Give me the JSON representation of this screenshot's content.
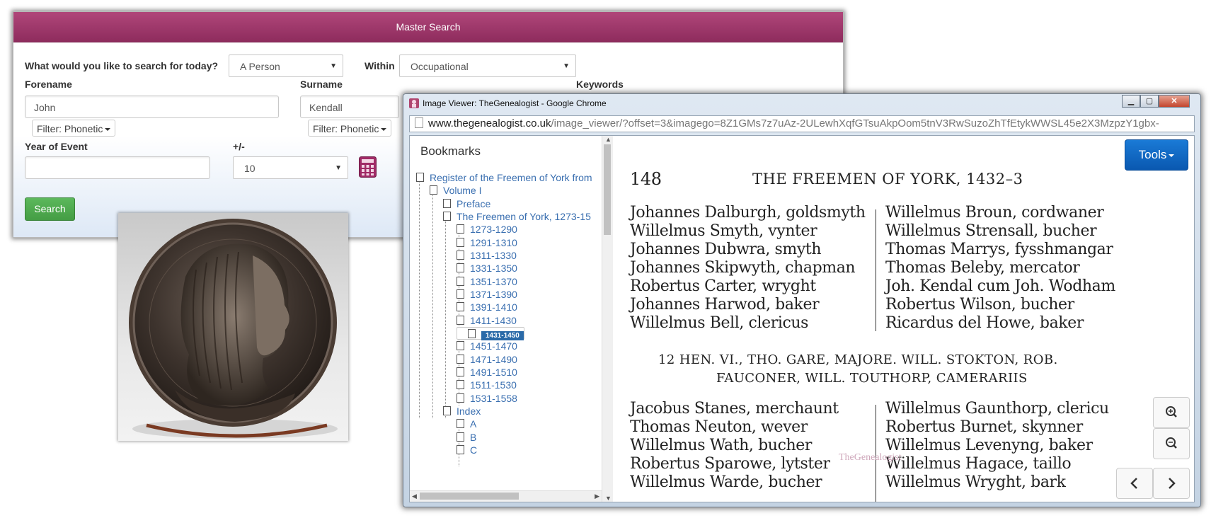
{
  "master_search": {
    "title": "Master Search",
    "question_label": "What would you like to search for today?",
    "search_type": "A Person",
    "within_label": "Within",
    "within_value": "Occupational",
    "forename_label": "Forename",
    "forename_value": "John",
    "forename_filter": "Filter: Phonetic",
    "surname_label": "Surname",
    "surname_value": "Kendall",
    "surname_filter": "Filter: Phonetic",
    "keywords_label": "Keywords",
    "year_label": "Year of Event",
    "year_value": "",
    "plusminus_label": "+/-",
    "plusminus_value": "10",
    "search_button": "Search",
    "calculator_icon": "calculator-icon"
  },
  "viewer": {
    "window_title": "Image Viewer: TheGenealogist - Google Chrome",
    "url_host": "www.thegenealogist.co.uk",
    "url_path": "/image_viewer/?offset=3&imagego=8Z1GMs7z7uAz-2ULewhXqfGTsuAkpOom5tnV3RwSuzoZhTfEtykWWSL45e2X3MzpzY1gbx-",
    "tools_label": "Tools",
    "bookmarks_title": "Bookmarks",
    "tree": {
      "root": "Register of the Freemen of York from",
      "volume": "Volume I",
      "preface": "Preface",
      "freemen": "The Freemen of York, 1273-15",
      "ranges": [
        "1273-1290",
        "1291-1310",
        "1311-1330",
        "1331-1350",
        "1351-1370",
        "1371-1390",
        "1391-1410",
        "1411-1430",
        "1431-1450",
        "1451-1470",
        "1471-1490",
        "1491-1510",
        "1511-1530",
        "1531-1558"
      ],
      "selected": "1431-1450",
      "index": "Index",
      "index_letters": [
        "A",
        "B",
        "C"
      ]
    },
    "document": {
      "page_number": "148",
      "running_title": "THE FREEMEN OF YORK, 1432–3",
      "left_col_1": [
        "Johannes Dalburgh, goldsmyth",
        "Willelmus Smyth, vynter",
        "Johannes Dubwra, smyth",
        "Johannes Skipwyth, chapman",
        "Robertus Carter, wryght",
        "Johannes Harwod, baker",
        "Willelmus Bell, clericus"
      ],
      "right_col_1": [
        "Willelmus Broun, cordwaner",
        "Willelmus Strensall, bucher",
        "Thomas Marrys, fysshmangar",
        "Thomas Beleby, mercator",
        "Joh. Kendal cum Joh. Wodham",
        "Robertus Wilson, bucher",
        "Ricardus del Howe, baker"
      ],
      "heading_line1": "12 HEN. VI., THO. GARE, MAJORE.  WILL. STOKTON, ROB.",
      "heading_line2": "FAUCONER, WILL. TOUTHORP, CAMERARIIS",
      "left_col_2": [
        "Jacobus Stanes, merchaunt",
        "Thomas Neuton, wever",
        "Willelmus Wath, bucher",
        "Robertus Sparowe, lytster",
        "Willelmus Warde, bucher"
      ],
      "right_col_2": [
        "Willelmus Gaunthorp, clericu",
        "Robertus Burnet, skynner",
        "Willelmus Levenyng, baker",
        "Willelmus Hagace, taillo",
        "Willelmus Wryght, bark"
      ],
      "watermark": "TheGenealogist"
    }
  }
}
